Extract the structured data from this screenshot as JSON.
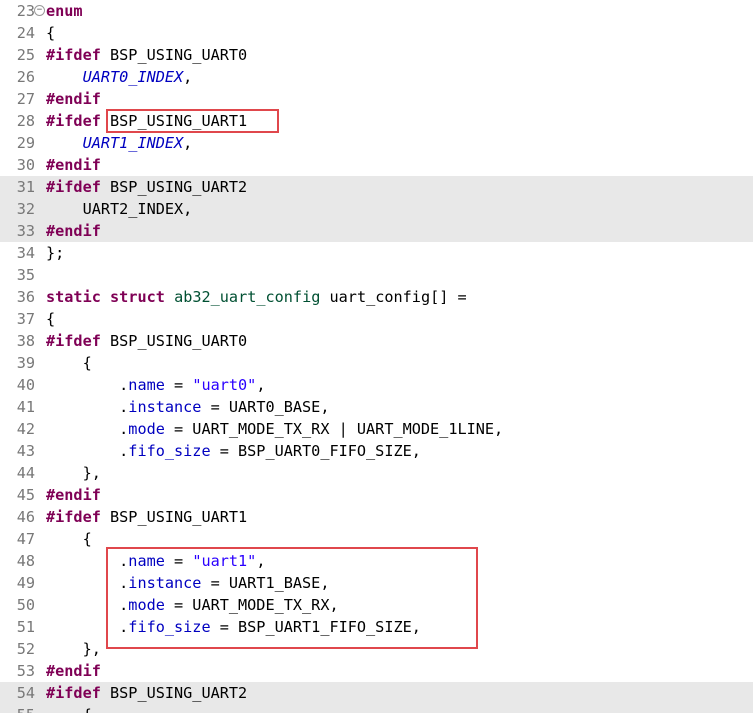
{
  "editor": {
    "lines": [
      {
        "num": "23",
        "fold": "⊖",
        "tokens": [
          {
            "t": "enum",
            "c": "kw"
          }
        ]
      },
      {
        "num": "24",
        "tokens": [
          {
            "t": "{"
          }
        ]
      },
      {
        "num": "25",
        "tokens": [
          {
            "t": "#ifdef",
            "c": "kw"
          },
          {
            "t": " BSP_USING_UART0"
          }
        ]
      },
      {
        "num": "26",
        "tokens": [
          {
            "t": "    "
          },
          {
            "t": "UART0_INDEX",
            "c": "en"
          },
          {
            "t": ","
          }
        ]
      },
      {
        "num": "27",
        "tokens": [
          {
            "t": "#endif",
            "c": "kw"
          }
        ]
      },
      {
        "num": "28",
        "tokens": [
          {
            "t": "#ifdef",
            "c": "kw"
          },
          {
            "t": " BSP_USING_UART1"
          }
        ]
      },
      {
        "num": "29",
        "tokens": [
          {
            "t": "    "
          },
          {
            "t": "UART1_INDEX",
            "c": "en"
          },
          {
            "t": ","
          }
        ]
      },
      {
        "num": "30",
        "tokens": [
          {
            "t": "#endif",
            "c": "kw"
          }
        ]
      },
      {
        "num": "31",
        "shaded": true,
        "tokens": [
          {
            "t": "#ifdef",
            "c": "kw"
          },
          {
            "t": " BSP_USING_UART2"
          }
        ]
      },
      {
        "num": "32",
        "shaded": true,
        "tokens": [
          {
            "t": "    UART2_INDEX,"
          }
        ]
      },
      {
        "num": "33",
        "shaded": true,
        "tokens": [
          {
            "t": "#endif",
            "c": "kw"
          }
        ]
      },
      {
        "num": "34",
        "tokens": [
          {
            "t": "};"
          }
        ]
      },
      {
        "num": "35",
        "tokens": []
      },
      {
        "num": "36",
        "tokens": [
          {
            "t": "static",
            "c": "kw"
          },
          {
            "t": " "
          },
          {
            "t": "struct",
            "c": "kw"
          },
          {
            "t": " "
          },
          {
            "t": "ab32_uart_config",
            "c": "type"
          },
          {
            "t": " uart_config[] ="
          }
        ]
      },
      {
        "num": "37",
        "tokens": [
          {
            "t": "{"
          }
        ]
      },
      {
        "num": "38",
        "tokens": [
          {
            "t": "#ifdef",
            "c": "kw"
          },
          {
            "t": " BSP_USING_UART0"
          }
        ]
      },
      {
        "num": "39",
        "tokens": [
          {
            "t": "    {"
          }
        ]
      },
      {
        "num": "40",
        "tokens": [
          {
            "t": "        ."
          },
          {
            "t": "name",
            "c": "fld"
          },
          {
            "t": " = "
          },
          {
            "t": "\"uart0\"",
            "c": "str"
          },
          {
            "t": ","
          }
        ]
      },
      {
        "num": "41",
        "tokens": [
          {
            "t": "        ."
          },
          {
            "t": "instance",
            "c": "fld"
          },
          {
            "t": " = UART0_BASE,"
          }
        ]
      },
      {
        "num": "42",
        "tokens": [
          {
            "t": "        ."
          },
          {
            "t": "mode",
            "c": "fld"
          },
          {
            "t": " = UART_MODE_TX_RX | UART_MODE_1LINE,"
          }
        ]
      },
      {
        "num": "43",
        "tokens": [
          {
            "t": "        ."
          },
          {
            "t": "fifo_size",
            "c": "fld"
          },
          {
            "t": " = BSP_UART0_FIFO_SIZE,"
          }
        ]
      },
      {
        "num": "44",
        "tokens": [
          {
            "t": "    },"
          }
        ]
      },
      {
        "num": "45",
        "tokens": [
          {
            "t": "#endif",
            "c": "kw"
          }
        ]
      },
      {
        "num": "46",
        "tokens": [
          {
            "t": "#ifdef",
            "c": "kw"
          },
          {
            "t": " BSP_USING_UART1"
          }
        ]
      },
      {
        "num": "47",
        "tokens": [
          {
            "t": "    {"
          }
        ]
      },
      {
        "num": "48",
        "tokens": [
          {
            "t": "        ."
          },
          {
            "t": "name",
            "c": "fld"
          },
          {
            "t": " = "
          },
          {
            "t": "\"uart1\"",
            "c": "str"
          },
          {
            "t": ","
          }
        ]
      },
      {
        "num": "49",
        "tokens": [
          {
            "t": "        ."
          },
          {
            "t": "instance",
            "c": "fld"
          },
          {
            "t": " = UART1_BASE,"
          }
        ]
      },
      {
        "num": "50",
        "tokens": [
          {
            "t": "        ."
          },
          {
            "t": "mode",
            "c": "fld"
          },
          {
            "t": " = UART_MODE_TX_RX,"
          }
        ]
      },
      {
        "num": "51",
        "tokens": [
          {
            "t": "        ."
          },
          {
            "t": "fifo_size",
            "c": "fld"
          },
          {
            "t": " = BSP_UART1_FIFO_SIZE,"
          }
        ]
      },
      {
        "num": "52",
        "tokens": [
          {
            "t": "    },"
          }
        ]
      },
      {
        "num": "53",
        "tokens": [
          {
            "t": "#endif",
            "c": "kw"
          }
        ]
      },
      {
        "num": "54",
        "shaded": true,
        "tokens": [
          {
            "t": "#ifdef",
            "c": "kw"
          },
          {
            "t": " BSP_USING_UART2"
          }
        ]
      },
      {
        "num": "55",
        "shaded": true,
        "tokens": [
          {
            "t": "    {"
          }
        ]
      }
    ]
  },
  "colors": {
    "keyword": "#7f0055",
    "string": "#2a00ff",
    "field": "#0000c0",
    "type": "#005032",
    "highlight_box": "#e0474c",
    "inactive_shading": "#e8e8e8"
  }
}
